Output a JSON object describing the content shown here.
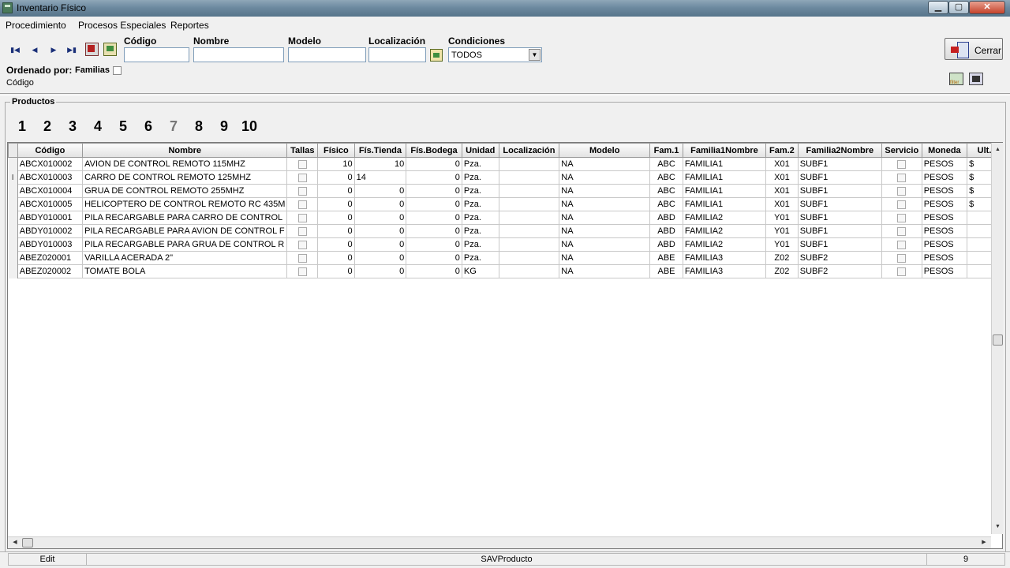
{
  "window": {
    "title": "Inventario Físico"
  },
  "menu": [
    "Procedimiento",
    "Procesos Especiales",
    "Reportes"
  ],
  "filters": {
    "codigo_label": "Código",
    "nombre_label": "Nombre",
    "modelo_label": "Modelo",
    "localizacion_label": "Localización",
    "condiciones_label": "Condiciones",
    "condiciones_value": "TODOS",
    "codigo_value": "",
    "nombre_value": "",
    "modelo_value": "",
    "localizacion_value": ""
  },
  "ordering": {
    "label": "Ordenado por:",
    "familias_label": "Familias",
    "familias_checked": false,
    "value": "Código"
  },
  "toolbar": {
    "close_label": "Cerrar"
  },
  "group": {
    "title": "Productos"
  },
  "pages": [
    "1",
    "2",
    "3",
    "4",
    "5",
    "6",
    "7",
    "8",
    "9",
    "10"
  ],
  "current_page": "7",
  "grid": {
    "columns": [
      "Código",
      "Nombre",
      "Tallas",
      "Físico",
      "Fís.Tienda",
      "Fís.Bodega",
      "Unidad",
      "Localización",
      "Modelo",
      "Fam.1",
      "Familia1Nombre",
      "Fam.2",
      "Familia2Nombre",
      "Servicio",
      "Moneda",
      "Ult."
    ],
    "rows": [
      {
        "indicator": "",
        "codigo": "ABCX010002",
        "nombre": "AVION DE CONTROL REMOTO 115MHZ",
        "fisico": "10",
        "tienda": "10",
        "bodega": "0",
        "unidad": "Pza.",
        "loc": "",
        "modelo": "NA",
        "fam1": "ABC",
        "fam1n": "FAMILIA1",
        "fam2": "X01",
        "fam2n": "SUBF1",
        "moneda": "PESOS",
        "ult": "$"
      },
      {
        "indicator": "I",
        "codigo": "ABCX010003",
        "nombre": "CARRO DE CONTROL REMOTO 125MHZ",
        "fisico": "0",
        "tienda": "14",
        "bodega": "0",
        "unidad": "Pza.",
        "loc": "",
        "modelo": "NA",
        "fam1": "ABC",
        "fam1n": "FAMILIA1",
        "fam2": "X01",
        "fam2n": "SUBF1",
        "moneda": "PESOS",
        "ult": "$"
      },
      {
        "indicator": "",
        "codigo": "ABCX010004",
        "nombre": "GRUA DE CONTROL REMOTO 255MHZ",
        "fisico": "0",
        "tienda": "0",
        "bodega": "0",
        "unidad": "Pza.",
        "loc": "",
        "modelo": "NA",
        "fam1": "ABC",
        "fam1n": "FAMILIA1",
        "fam2": "X01",
        "fam2n": "SUBF1",
        "moneda": "PESOS",
        "ult": "$"
      },
      {
        "indicator": "",
        "codigo": "ABCX010005",
        "nombre": "HELICOPTERO DE CONTROL REMOTO RC 435M",
        "fisico": "0",
        "tienda": "0",
        "bodega": "0",
        "unidad": "Pza.",
        "loc": "",
        "modelo": "NA",
        "fam1": "ABC",
        "fam1n": "FAMILIA1",
        "fam2": "X01",
        "fam2n": "SUBF1",
        "moneda": "PESOS",
        "ult": "$"
      },
      {
        "indicator": "",
        "codigo": "ABDY010001",
        "nombre": "PILA RECARGABLE PARA CARRO DE CONTROL",
        "fisico": "0",
        "tienda": "0",
        "bodega": "0",
        "unidad": "Pza.",
        "loc": "",
        "modelo": "NA",
        "fam1": "ABD",
        "fam1n": "FAMILIA2",
        "fam2": "Y01",
        "fam2n": "SUBF1",
        "moneda": "PESOS",
        "ult": ""
      },
      {
        "indicator": "",
        "codigo": "ABDY010002",
        "nombre": "PILA RECARGABLE PARA AVION DE CONTROL F",
        "fisico": "0",
        "tienda": "0",
        "bodega": "0",
        "unidad": "Pza.",
        "loc": "",
        "modelo": "NA",
        "fam1": "ABD",
        "fam1n": "FAMILIA2",
        "fam2": "Y01",
        "fam2n": "SUBF1",
        "moneda": "PESOS",
        "ult": ""
      },
      {
        "indicator": "",
        "codigo": "ABDY010003",
        "nombre": "PILA RECARGABLE PARA GRUA DE CONTROL R",
        "fisico": "0",
        "tienda": "0",
        "bodega": "0",
        "unidad": "Pza.",
        "loc": "",
        "modelo": "NA",
        "fam1": "ABD",
        "fam1n": "FAMILIA2",
        "fam2": "Y01",
        "fam2n": "SUBF1",
        "moneda": "PESOS",
        "ult": ""
      },
      {
        "indicator": "",
        "codigo": "ABEZ020001",
        "nombre": "VARILLA ACERADA 2\"",
        "fisico": "0",
        "tienda": "0",
        "bodega": "0",
        "unidad": "Pza.",
        "loc": "",
        "modelo": "NA",
        "fam1": "ABE",
        "fam1n": "FAMILIA3",
        "fam2": "Z02",
        "fam2n": "SUBF2",
        "moneda": "PESOS",
        "ult": ""
      },
      {
        "indicator": "",
        "codigo": "ABEZ020002",
        "nombre": "TOMATE BOLA",
        "fisico": "0",
        "tienda": "0",
        "bodega": "0",
        "unidad": "KG",
        "loc": "",
        "modelo": "NA",
        "fam1": "ABE",
        "fam1n": "FAMILIA3",
        "fam2": "Z02",
        "fam2n": "SUBF2",
        "moneda": "PESOS",
        "ult": ""
      }
    ]
  },
  "status": {
    "mode": "Edit",
    "table": "SAVProducto",
    "count": "9"
  },
  "icons": {
    "nav_first": "first-record-icon",
    "nav_prev": "prev-record-icon",
    "nav_next": "next-record-icon",
    "nav_last": "last-record-icon",
    "export": "export-icon",
    "search": "search-icon",
    "close": "close-door-icon"
  }
}
